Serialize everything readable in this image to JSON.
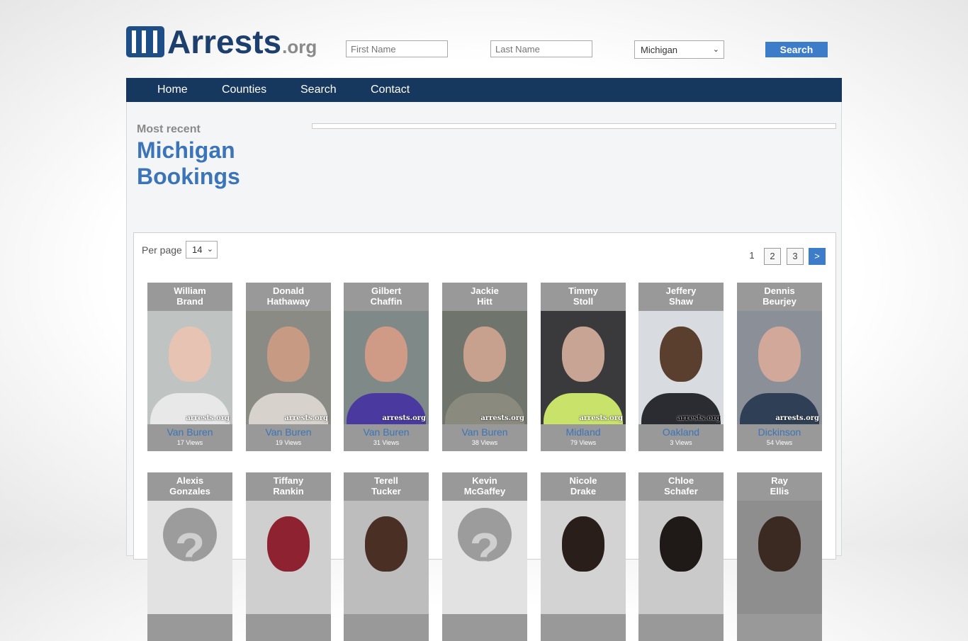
{
  "header": {
    "logo_text": "Arrests",
    "logo_suffix": ".org",
    "first_name_placeholder": "First Name",
    "last_name_placeholder": "Last Name",
    "state_selected": "Michigan",
    "search_label": "Search"
  },
  "nav": {
    "home": "Home",
    "counties": "Counties",
    "search": "Search",
    "contact": "Contact"
  },
  "page": {
    "subtitle": "Most recent",
    "title_line1": "Michigan",
    "title_line2": "Bookings"
  },
  "list": {
    "per_page_label": "Per page",
    "per_page_value": "14",
    "pages": [
      "1",
      "2",
      "3"
    ],
    "next_label": ">"
  },
  "colors": {
    "brand_navy": "#16375e",
    "accent_blue": "#3d7cc9",
    "card_gray": "#999999"
  },
  "bookings": [
    {
      "first": "William",
      "last": "Brand",
      "county": "Van Buren",
      "views": "17 Views",
      "watermark": "arrests.org"
    },
    {
      "first": "Donald",
      "last": "Hathaway",
      "county": "Van Buren",
      "views": "19 Views",
      "watermark": "arrests.org"
    },
    {
      "first": "Gilbert",
      "last": "Chaffin",
      "county": "Van Buren",
      "views": "31 Views",
      "watermark": "arrests.org"
    },
    {
      "first": "Jackie",
      "last": "Hitt",
      "county": "Van Buren",
      "views": "38 Views",
      "watermark": "arrests.org"
    },
    {
      "first": "Timmy",
      "last": "Stoll",
      "county": "Midland",
      "views": "79 Views",
      "watermark": "arrests.org"
    },
    {
      "first": "Jeffery",
      "last": "Shaw",
      "county": "Oakland",
      "views": "3 Views",
      "watermark": "arrests.org"
    },
    {
      "first": "Dennis",
      "last": "Beurjey",
      "county": "Dickinson",
      "views": "54 Views",
      "watermark": "arrests.org"
    },
    {
      "first": "Alexis",
      "last": "Gonzales"
    },
    {
      "first": "Tiffany",
      "last": "Rankin"
    },
    {
      "first": "Terell",
      "last": "Tucker"
    },
    {
      "first": "Kevin",
      "last": "McGaffey"
    },
    {
      "first": "Nicole",
      "last": "Drake"
    },
    {
      "first": "Chloe",
      "last": "Schafer"
    },
    {
      "first": "Ray",
      "last": "Ellis"
    }
  ]
}
